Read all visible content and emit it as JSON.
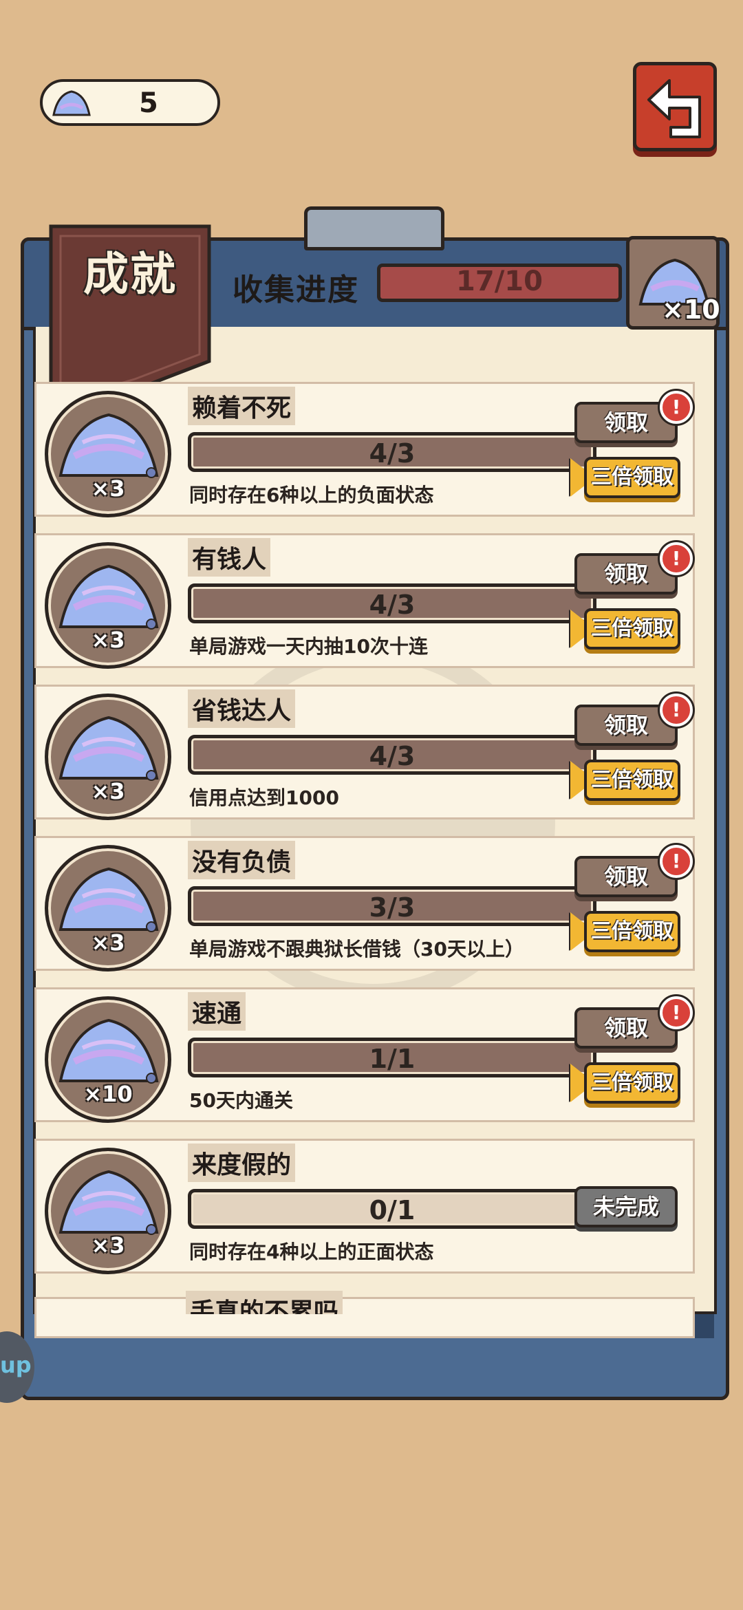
{
  "currency": {
    "icon": "crystal-icon",
    "count": "5"
  },
  "back_button": {
    "icon": "return-arrow-icon"
  },
  "header": {
    "tab_title": "成就",
    "progress_label": "收集进度",
    "progress_text": "17/10",
    "progress_fraction": 1.0,
    "reward_count": "×10"
  },
  "achievements": [
    {
      "title": "赖着不死",
      "progress": "4/3",
      "fill": 1.0,
      "reward": "×3",
      "desc": "同时存在6种以上的负面状态",
      "claim": "领取",
      "triple": "三倍领取",
      "alert": "!"
    },
    {
      "title": "有钱人",
      "progress": "4/3",
      "fill": 1.0,
      "reward": "×3",
      "desc": "单局游戏一天内抽10次十连",
      "claim": "领取",
      "triple": "三倍领取",
      "alert": "!"
    },
    {
      "title": "省钱达人",
      "progress": "4/3",
      "fill": 1.0,
      "reward": "×3",
      "desc": "信用点达到1000",
      "claim": "领取",
      "triple": "三倍领取",
      "alert": "!"
    },
    {
      "title": "没有负债",
      "progress": "3/3",
      "fill": 1.0,
      "reward": "×3",
      "desc": "单局游戏不跟典狱长借钱（30天以上）",
      "claim": "领取",
      "triple": "三倍领取",
      "alert": "!"
    },
    {
      "title": "速通",
      "progress": "1/1",
      "fill": 1.0,
      "reward": "×10",
      "desc": "50天内通关",
      "claim": "领取",
      "triple": "三倍领取",
      "alert": "!"
    },
    {
      "title": "来度假的",
      "progress": "0/1",
      "fill": 0.0,
      "reward": "×3",
      "desc": "同时存在4种以上的正面状态",
      "status": "未完成"
    }
  ],
  "partial_row": {
    "title": "手真的不累吗"
  },
  "side_button": {
    "text": "up"
  },
  "colors": {
    "background": "#deba8d",
    "board": "#4c6b92",
    "paper": "#f6ecd5",
    "claim_button": "#8e7566",
    "triple_button": "#f2b733",
    "alert": "#d9413a"
  }
}
